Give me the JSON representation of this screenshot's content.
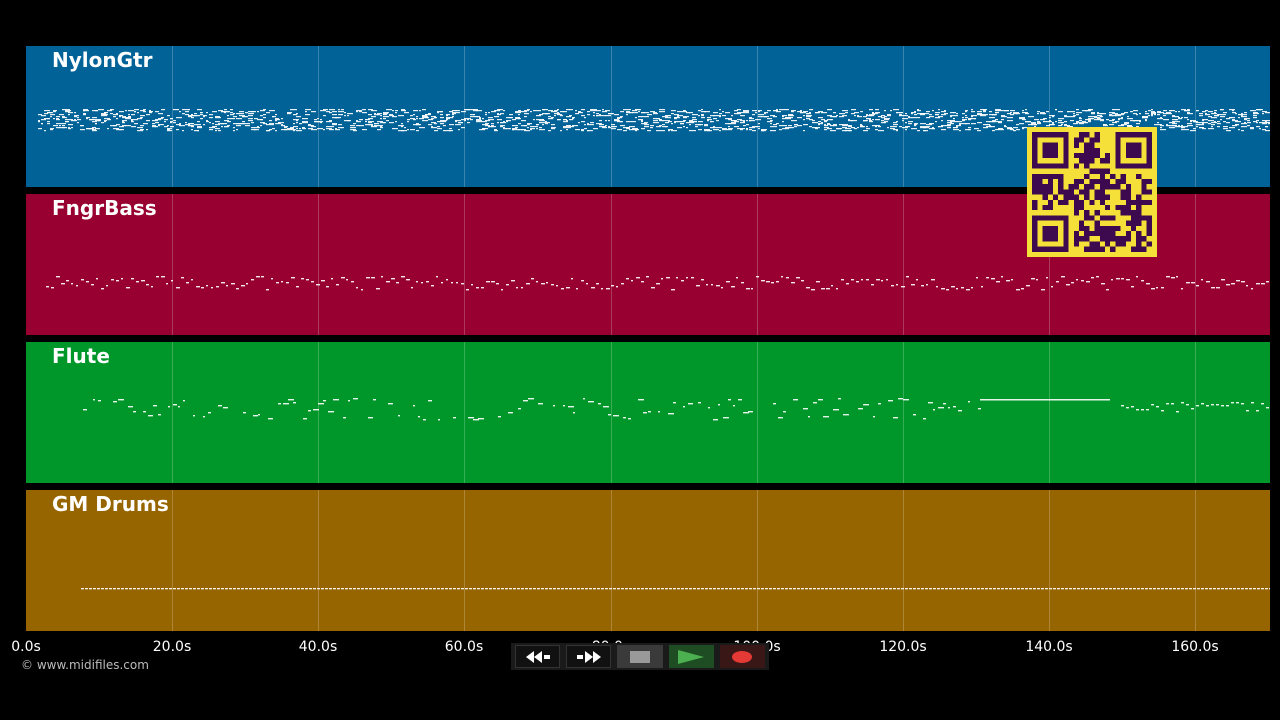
{
  "tracks": [
    {
      "name": "NylonGtr",
      "color": "#006297"
    },
    {
      "name": "FngrBass",
      "color": "#970030"
    },
    {
      "name": "Flute",
      "color": "#00972A"
    },
    {
      "name": "GM Drums",
      "color": "#976500"
    }
  ],
  "timeline": {
    "labels": [
      "0.0s",
      "20.0s",
      "40.0s",
      "60.0s",
      "80.0s",
      "100.0s",
      "120.0s",
      "140.0s",
      "160.0s"
    ]
  },
  "copyright": "© www.midifiles.com",
  "transport": {
    "buttons": [
      {
        "icon": "rewind-icon"
      },
      {
        "icon": "fast-forward-icon"
      },
      {
        "icon": "stop-icon"
      },
      {
        "icon": "play-icon"
      },
      {
        "icon": "record-icon"
      }
    ]
  },
  "qr": {
    "icon": "qr-code-icon",
    "fg": "#3D0A4F",
    "bg": "#F5E03A"
  }
}
